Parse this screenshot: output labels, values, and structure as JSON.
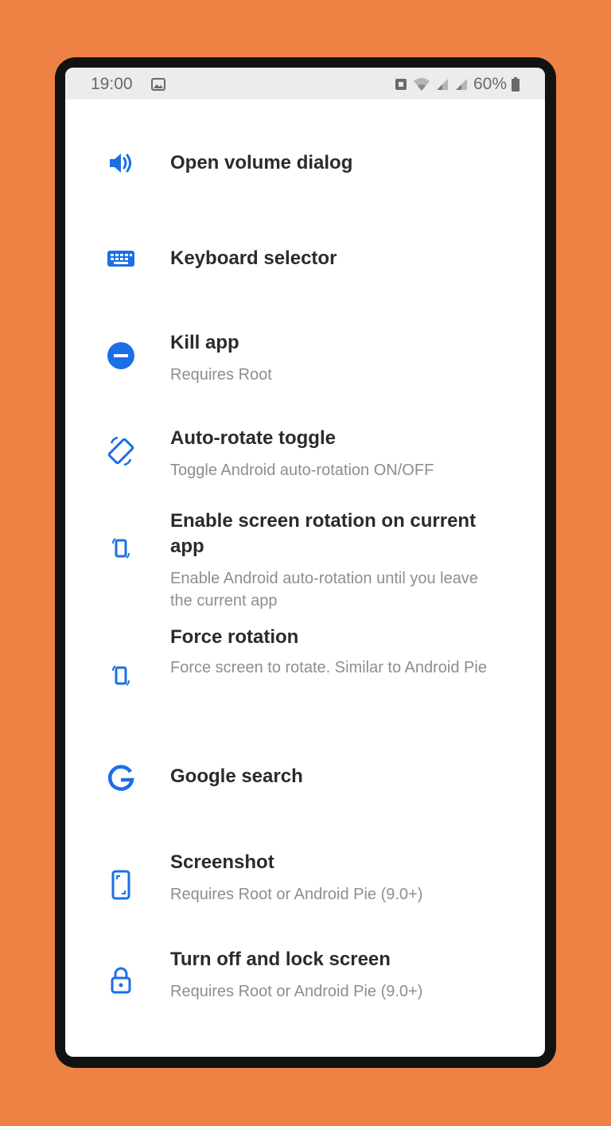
{
  "status_bar": {
    "time": "19:00",
    "battery": "60%"
  },
  "colors": {
    "background": "#ED8244",
    "accent": "#1A6FE6",
    "title_text": "#2B2B2B",
    "subtitle_text": "#8E8E8E"
  },
  "actions": [
    {
      "title": "Open volume dialog",
      "subtitle": "",
      "icon": "volume-icon"
    },
    {
      "title": "Keyboard selector",
      "subtitle": "",
      "icon": "keyboard-icon"
    },
    {
      "title": "Kill app",
      "subtitle": "Requires Root",
      "icon": "minus-circle-icon"
    },
    {
      "title": "Auto-rotate toggle",
      "subtitle": "Toggle Android auto-rotation ON/OFF",
      "icon": "screen-rotation-icon"
    },
    {
      "title": "Enable screen rotation on current app",
      "subtitle": "Enable Android auto-rotation until you leave the current app",
      "icon": "rotation-lock-icon"
    },
    {
      "title": "Force rotation",
      "subtitle": "Force screen to rotate. Similar to Android Pie",
      "icon": "rotation-lock-icon"
    },
    {
      "title": "Google search",
      "subtitle": "",
      "icon": "google-icon"
    },
    {
      "title": "Screenshot",
      "subtitle": "Requires Root or Android Pie (9.0+)",
      "icon": "screenshot-icon"
    },
    {
      "title": "Turn off and lock screen",
      "subtitle": "Requires Root or Android Pie (9.0+)",
      "icon": "lock-icon"
    }
  ]
}
